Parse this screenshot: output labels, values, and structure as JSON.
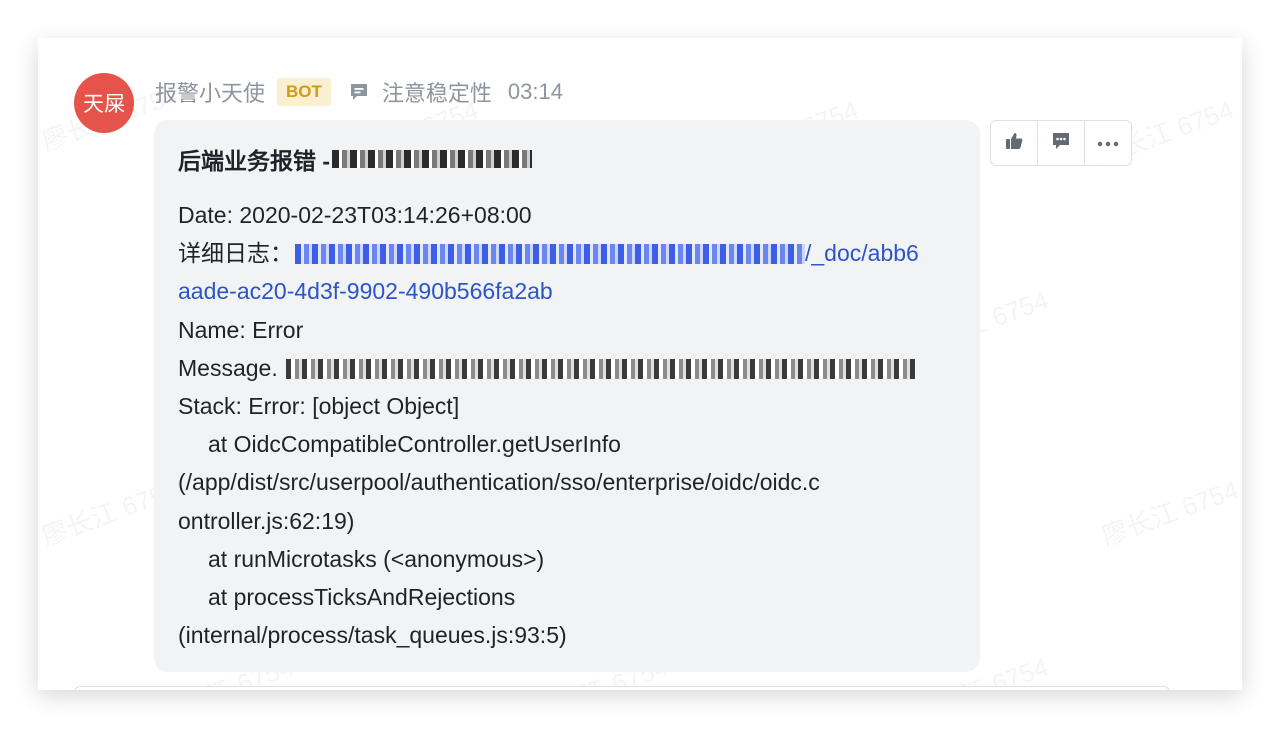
{
  "message": {
    "avatar_text": "天屎",
    "sender": "报警小天使",
    "badge": "BOT",
    "thread_title": "注意稳定性",
    "time": "03:14",
    "title_prefix": "后端业务报错 -",
    "lines": {
      "date": "Date: 2020-02-23T03:14:26+08:00",
      "log_label": "详细日志：",
      "log_link_end": "/_doc/abb6",
      "log_link_line2": "aade-ac20-4d3f-9902-490b566fa2ab",
      "name": "Name: Error",
      "message_label": "Message.",
      "stack": "Stack: Error: [object Object]",
      "at1": "at OidcCompatibleController.getUserInfo",
      "path1a": "(/app/dist/src/userpool/authentication/sso/enterprise/oidc/oidc.c",
      "path1b": "ontroller.js:62:19)",
      "at2": "at runMicrotasks (<anonymous>)",
      "at3": "at processTicksAndRejections",
      "path3": "(internal/process/task_queues.js:93:5)"
    }
  },
  "actions": {
    "like_icon": "thumbs-up-icon",
    "reply_icon": "comment-icon",
    "more_icon": "more-icon"
  },
  "watermark": "廖长江 6754",
  "colors": {
    "avatar": "#e5534b",
    "badge_bg": "#fbefd2",
    "badge_text": "#d29a13",
    "link": "#2b55c8",
    "bubble": "#f2f3f5"
  }
}
